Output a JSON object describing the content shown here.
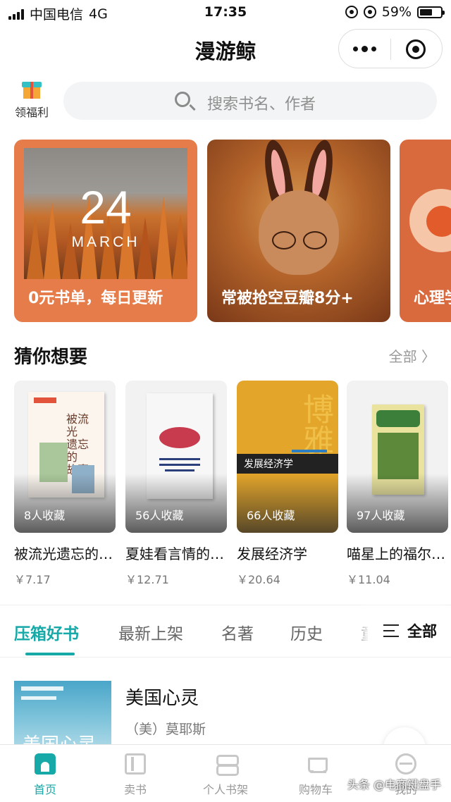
{
  "status_bar": {
    "carrier": "中国电信",
    "network": "4G",
    "time": "17:35",
    "battery": "59%",
    "battery_level": 0.59
  },
  "nav": {
    "title": "漫游鲸"
  },
  "welfare": {
    "label": "领福利"
  },
  "search": {
    "placeholder": "搜索书名、作者"
  },
  "banners": [
    {
      "caption": "0元书单，每日更新",
      "day": "24",
      "month": "MARCH"
    },
    {
      "caption": "常被抢空豆瓣8分+"
    },
    {
      "caption": "心理学"
    }
  ],
  "guess": {
    "title": "猜你想要",
    "more": "全部 〉",
    "books": [
      {
        "name": "被流光遗忘的…",
        "price": "￥7.17",
        "favorites": "8人收藏"
      },
      {
        "name": "夏娃看言情的…",
        "price": "￥12.71",
        "favorites": "56人收藏"
      },
      {
        "name": "发展经济学",
        "price": "￥20.64",
        "favorites": "66人收藏",
        "cover_text": "发展经济学",
        "cover_big": "博雅"
      },
      {
        "name": "喵星上的福尔…",
        "price": "￥11.04",
        "favorites": "97人收藏"
      }
    ]
  },
  "tabs": {
    "items": [
      "压箱好书",
      "最新上架",
      "名著",
      "历史",
      "童"
    ],
    "active": 0,
    "all_label": "全部"
  },
  "list_item": {
    "title": "美国心灵",
    "author": "（美）莫耶斯",
    "cover_text": "美国心灵"
  },
  "tabbar": {
    "items": [
      "首页",
      "卖书",
      "个人书架",
      "购物车",
      "我的"
    ],
    "active": 0
  },
  "watermark": "头条 @电商键盘手",
  "colors": {
    "accent": "#17a8a8",
    "banner1": "#e67c49"
  }
}
